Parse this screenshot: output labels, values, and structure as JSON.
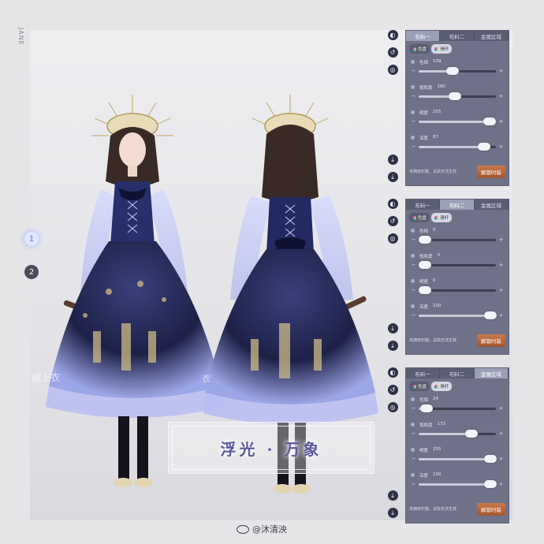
{
  "side_mark": "JANE",
  "float_buttons": [
    "1",
    "2"
  ],
  "watermark_left": "成上衣",
  "watermark_right": "衣",
  "caption": "浮光 · 万象",
  "credit": "@沐清泱",
  "icon_labels": {
    "top": [
      "",
      "",
      ""
    ],
    "bottom": [
      "",
      ""
    ]
  },
  "panels": [
    {
      "tabs": [
        "布料一",
        "布料二",
        "金属区域"
      ],
      "active_tab": 0,
      "modes": [
        "色盘",
        "滑杆"
      ],
      "active_mode": 1,
      "sliders": [
        {
          "label": "色相",
          "value": "109",
          "fraction": 0.44
        },
        {
          "label": "饱和度",
          "value": "180",
          "fraction": 0.47
        },
        {
          "label": "明度",
          "value": "255",
          "fraction": 0.92
        },
        {
          "label": "深度",
          "value": "87",
          "fraction": 0.85
        }
      ],
      "note": "未拥有时装，试染无法生效",
      "button": "解锁时装"
    },
    {
      "tabs": [
        "布料一",
        "布料二",
        "金属区域"
      ],
      "active_tab": 1,
      "modes": [
        "色盘",
        "滑杆"
      ],
      "active_mode": 1,
      "sliders": [
        {
          "label": "色相",
          "value": "0",
          "fraction": 0.0
        },
        {
          "label": "饱和度",
          "value": "0",
          "fraction": 0.0
        },
        {
          "label": "明度",
          "value": "0",
          "fraction": 0.0
        },
        {
          "label": "深度",
          "value": "100",
          "fraction": 0.93
        }
      ],
      "note": "未拥有时装，试染无法生效",
      "button": "解锁时装"
    },
    {
      "tabs": [
        "布料一",
        "布料二",
        "金属区域"
      ],
      "active_tab": 2,
      "modes": [
        "色盘",
        "滑杆"
      ],
      "active_mode": 1,
      "sliders": [
        {
          "label": "色相",
          "value": "24",
          "fraction": 0.1
        },
        {
          "label": "饱和度",
          "value": "173",
          "fraction": 0.68
        },
        {
          "label": "明度",
          "value": "255",
          "fraction": 0.93
        },
        {
          "label": "深度",
          "value": "100",
          "fraction": 0.93
        }
      ],
      "note": "未拥有时装，试染无法生效",
      "button": "解锁时装"
    }
  ]
}
